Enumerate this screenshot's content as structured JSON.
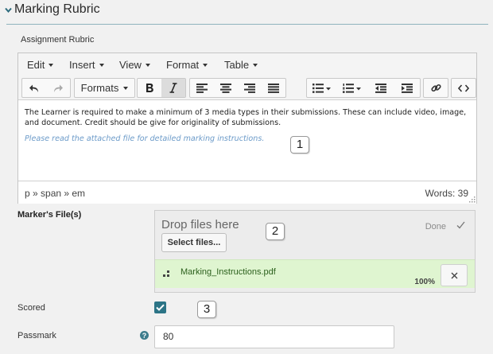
{
  "section": {
    "title": "Marking Rubric"
  },
  "rubric": {
    "label": "Assignment Rubric",
    "menus": [
      "Edit",
      "Insert",
      "View",
      "Format",
      "Table"
    ],
    "formats_label": "Formats",
    "body_text": "The Learner is required to make a minimum of 3 media types in their submissions.  These can include video, image, and document.  Credit should be give for originality of submissions.",
    "emphasis_text": "Please read the attached file for detailed marking instructions.",
    "path": "p » span » em",
    "word_count": "Words: 39"
  },
  "callouts": [
    "1",
    "2",
    "3"
  ],
  "markers_files": {
    "label": "Marker's File(s)",
    "drop_label": "Drop files here",
    "select_button": "Select files...",
    "done_label": "Done",
    "file_name": "Marking_Instructions.pdf",
    "progress_text": "100%"
  },
  "scored": {
    "label": "Scored",
    "checked": true
  },
  "passmark": {
    "label": "Passmark",
    "value": "80"
  },
  "colors": {
    "accent": "#2c7486",
    "upload_success": "#dff5d0",
    "italic_text": "#6c9bc9"
  }
}
